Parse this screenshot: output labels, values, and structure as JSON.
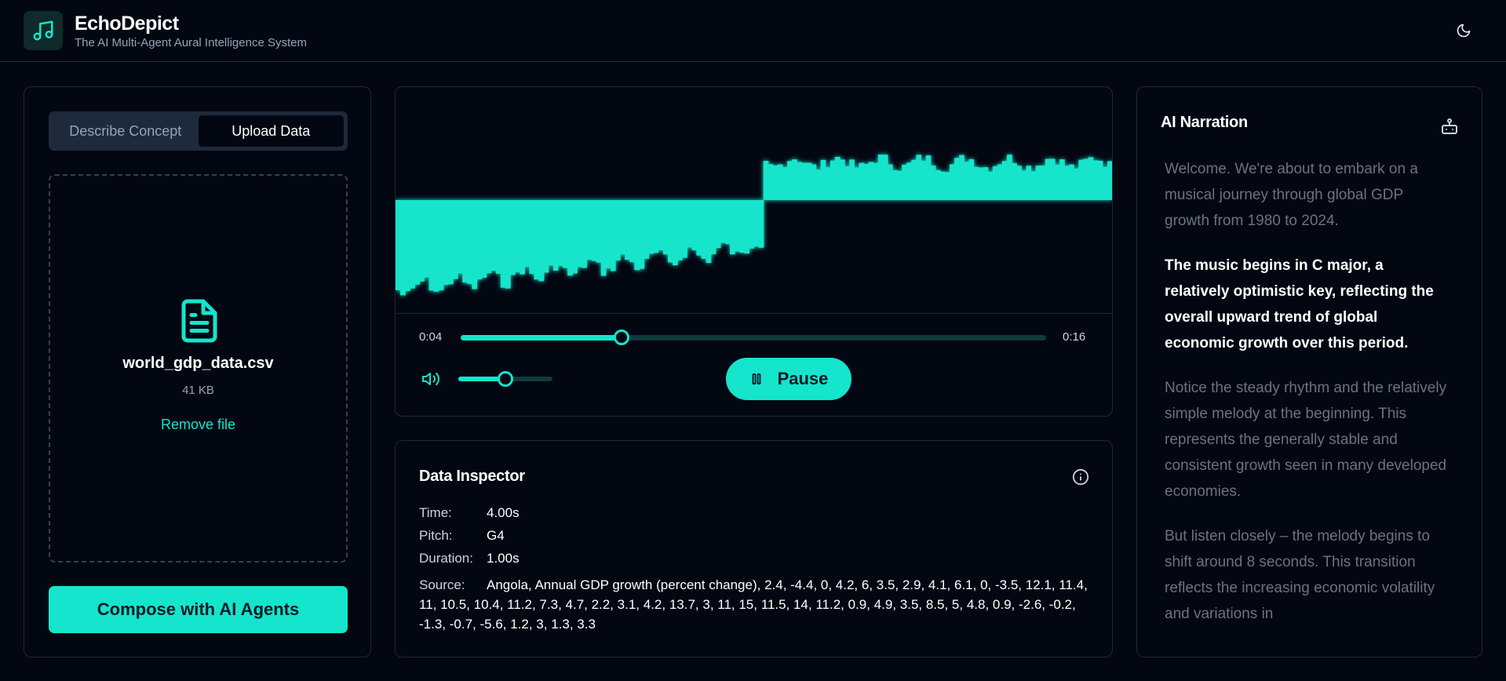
{
  "header": {
    "app_name": "EchoDepict",
    "tagline": "The AI Multi-Agent Aural Intelligence System",
    "logo_icon": "music-note-icon",
    "theme_toggle_icon": "moon-icon"
  },
  "input_panel": {
    "tabs": [
      {
        "label": "Describe Concept",
        "active": false
      },
      {
        "label": "Upload Data",
        "active": true
      }
    ],
    "file": {
      "icon": "file-text-icon",
      "name": "world_gdp_data.csv",
      "size": "41 KB",
      "remove_label": "Remove file"
    },
    "compose_label": "Compose with AI Agents"
  },
  "player": {
    "current_time": "0:04",
    "total_time": "0:16",
    "progress": 0.275,
    "volume": 0.5,
    "volume_icon": "volume-icon",
    "pause_icon": "pause-icon",
    "pause_label": "Pause",
    "accent_color": "#14e5cc"
  },
  "inspector": {
    "title": "Data Inspector",
    "info_icon": "info-icon",
    "time_label": "Time:",
    "time_value": "4.00s",
    "pitch_label": "Pitch:",
    "pitch_value": "G4",
    "duration_label": "Duration:",
    "duration_value": "1.00s",
    "source_label": "Source:",
    "source_value": "Angola, Annual GDP growth (percent change), 2.4, -4.4, 0, 4.2, 6, 3.5, 2.9, 4.1, 6.1, 0, -3.5, 12.1, 11.4, 11, 10.5, 10.4, 11.2, 7.3, 4.7, 2.2, 3.1, 4.2, 13.7, 3, 11, 15, 11.5, 14, 11.2, 0.9, 4.9, 3.5, 8.5, 5, 4.8, 0.9, -2.6, -0.2, -1.3, -0.7, -5.6, 1.2, 3, 1.3, 3.3"
  },
  "narration": {
    "title": "AI Narration",
    "bot_icon": "bot-icon",
    "paragraphs": [
      {
        "text": "Welcome. We're about to embark on a musical journey through global GDP growth from 1980 to 2024.",
        "active": false
      },
      {
        "text": "The music begins in C major, a relatively optimistic key, reflecting the overall upward trend of global economic growth over this period.",
        "active": true
      },
      {
        "text": "Notice the steady rhythm and the relatively simple melody at the beginning. This represents the generally stable and consistent growth seen in many developed economies.",
        "active": false
      },
      {
        "text": "But listen closely – the melody begins to shift around 8 seconds. This transition reflects the increasing economic volatility and variations in",
        "active": false
      }
    ]
  }
}
